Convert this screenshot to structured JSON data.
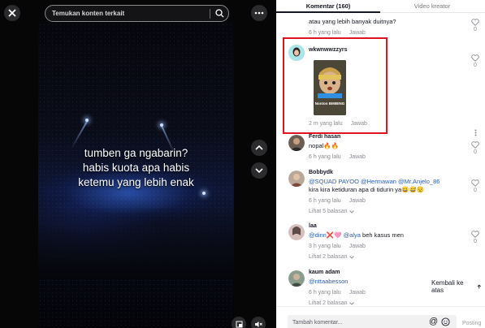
{
  "video": {
    "search_placeholder": "Temukan konten terkait",
    "caption_lines": [
      "tumben ga ngabarin?",
      "habis kuota apa habis",
      "ketemu yang lebih enak"
    ]
  },
  "tabs": [
    {
      "label": "Komentar (160)",
      "active": true
    },
    {
      "label": "Video kreator",
      "active": false
    }
  ],
  "comments": [
    {
      "id": "c0",
      "username": "",
      "text": "atau yang lebih banyak duitnya?",
      "time": "6 h yang lalu",
      "reply": "Jawab",
      "likes": "0"
    },
    {
      "id": "c1",
      "username": "wkwnwwzzyrs",
      "text": "",
      "sticker_caption": "Nonton BIMBING",
      "time": "2 m yang lalu",
      "reply": "Jawab",
      "likes": "0"
    },
    {
      "id": "c2",
      "username": "Ferdi hasan",
      "text": "nopal🔥🔥",
      "time": "6 h yang lalu",
      "reply": "Jawab",
      "likes": "0"
    },
    {
      "id": "c3",
      "username": "Bobbydk",
      "mentions": [
        "@SQUAD PAYOO",
        "@Hermawan",
        "@Mr.Anjelo_86"
      ],
      "text": "kira kira ketiduran apa di tidurin ya😄😅😟",
      "time": "6 h yang lalu",
      "reply": "Jawab",
      "likes": "0",
      "replies": "Lihat 5 balasan"
    },
    {
      "id": "c4",
      "username": "laa",
      "mentions": [
        "@dinn❌🩷",
        "@alya"
      ],
      "text": "beh kasus men",
      "time": "3 h yang lalu",
      "reply": "Jawab",
      "likes": "0",
      "replies": "Lihat 2 balasan"
    },
    {
      "id": "c5",
      "username": "kaum adam",
      "mentions": [
        "@nttaabesson"
      ],
      "text": "",
      "time": "6 h yang lalu",
      "reply": "Jawab",
      "likes": "",
      "replies": "Lihat 2 balasan"
    }
  ],
  "back_to_top": "Kembali ke atas",
  "input": {
    "placeholder": "Tambah komentar...",
    "post_label": "Posting"
  },
  "colors": {
    "highlight": "#e0141f",
    "mention": "#2b5db9"
  }
}
